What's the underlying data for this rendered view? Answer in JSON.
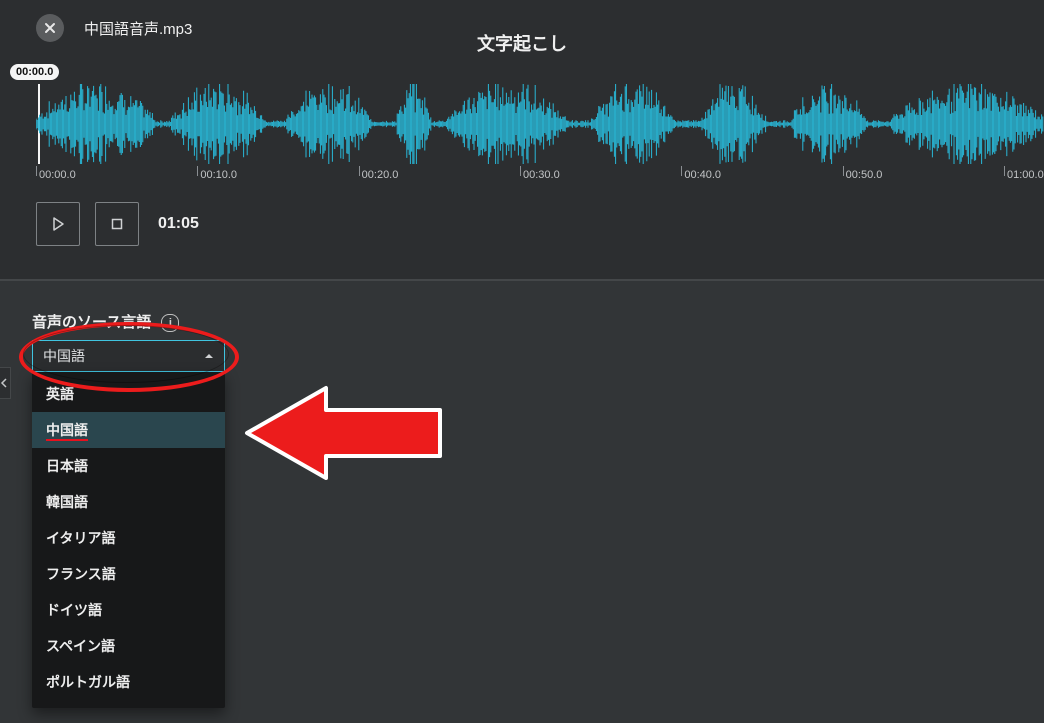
{
  "header": {
    "file_name": "中国語音声.mp3",
    "page_title": "文字起こし"
  },
  "waveform": {
    "playhead_time": "00:00.0",
    "ticks": [
      "00:00.0",
      "00:10.0",
      "00:20.0",
      "00:30.0",
      "00:40.0",
      "00:50.0",
      "01:00.0"
    ]
  },
  "playback": {
    "time_readout": "01:05"
  },
  "language": {
    "section_label": "音声のソース言語",
    "selected": "中国語",
    "options": [
      "英語",
      "中国語",
      "日本語",
      "韓国語",
      "イタリア語",
      "フランス語",
      "ドイツ語",
      "スペイン語",
      "ポルトガル語"
    ],
    "highlighted_index": 1
  }
}
